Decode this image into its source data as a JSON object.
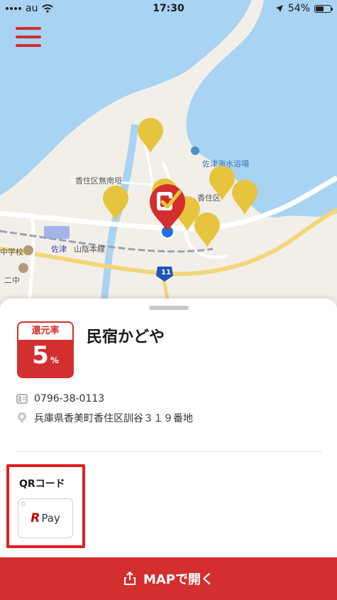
{
  "status_bar": {
    "carrier": "au",
    "time": "17:30",
    "battery_percent": "54%",
    "battery_level": 0.54
  },
  "map": {
    "labels": {
      "district": "香住区無南垣",
      "beach": "佐津海水浴場",
      "town": "香住区",
      "school": "中学校",
      "school2": "二中",
      "station": "佐津",
      "rail": "山陰本線",
      "route": "11"
    },
    "icons": {
      "menu": "hamburger-menu-icon",
      "selected_pin": "checkmark-pin-icon",
      "location": "current-location-icon"
    },
    "colors": {
      "water": "#a9d3f2",
      "land": "#f2efe9",
      "pin_yellow": "#e6c43d",
      "pin_red": "#d32f2f",
      "location_blue": "#1a73e8"
    }
  },
  "shop": {
    "rate_label": "還元率",
    "rate_value": "5",
    "rate_unit": "%",
    "name": "民宿かどや",
    "phone": "0796-38-0113",
    "address": "兵庫県香美町香住区訓谷３１９番地"
  },
  "payment": {
    "section_label": "QRコード",
    "method_r": "R",
    "method_text": "Pay"
  },
  "action": {
    "open_map_label": "MAPで開く"
  },
  "accent_color": "#d32f2f"
}
